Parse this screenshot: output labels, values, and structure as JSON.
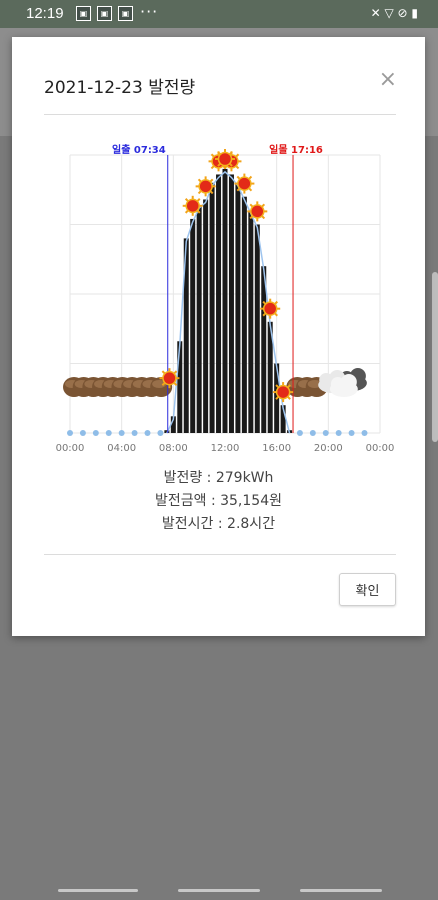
{
  "status_bar": {
    "time": "12:19",
    "app_icon_a": "image-icon",
    "app_icon_b": "▣",
    "app_icon_c": "▣",
    "more": "···",
    "right_icons": "✕ ▽ ⊘ ▮"
  },
  "dialog": {
    "title": "2021-12-23 발전량",
    "close_symbol": "×",
    "summary": {
      "generation": "발전량 : 279kWh",
      "amount": "발전금액 : 35,154원",
      "hours": "발전시간 : 2.8시간"
    },
    "confirm_label": "확인"
  },
  "chart_data": {
    "type": "bar",
    "x_ticks": [
      "00:00",
      "04:00",
      "08:00",
      "12:00",
      "16:00",
      "20:00",
      "00:00"
    ],
    "hours": [
      7.5,
      8,
      8.5,
      9,
      9.5,
      10,
      10.5,
      11,
      11.5,
      12,
      12.5,
      13,
      13.5,
      14,
      14.5,
      15,
      15.5,
      16,
      16.5,
      17
    ],
    "values": [
      1,
      6,
      33,
      70,
      77,
      82,
      84,
      90,
      93,
      95,
      93,
      90,
      85,
      80,
      75,
      60,
      40,
      25,
      10,
      1
    ],
    "ylim": [
      0,
      100
    ],
    "grid": true,
    "sunrise_label": "일출 07:34",
    "sunset_label": "일몰 17:16",
    "sunrise_hour": 7.567,
    "sunset_hour": 17.267,
    "colors": {
      "bar": "#1a1a1a",
      "sunrise": "#2b2bdd",
      "sunset": "#e01818",
      "trend": "#9ec4ee",
      "dot": "#8fbde8",
      "grid": "#e6e6e6"
    },
    "weather_icons": "sun-icon, cloud-icon"
  }
}
